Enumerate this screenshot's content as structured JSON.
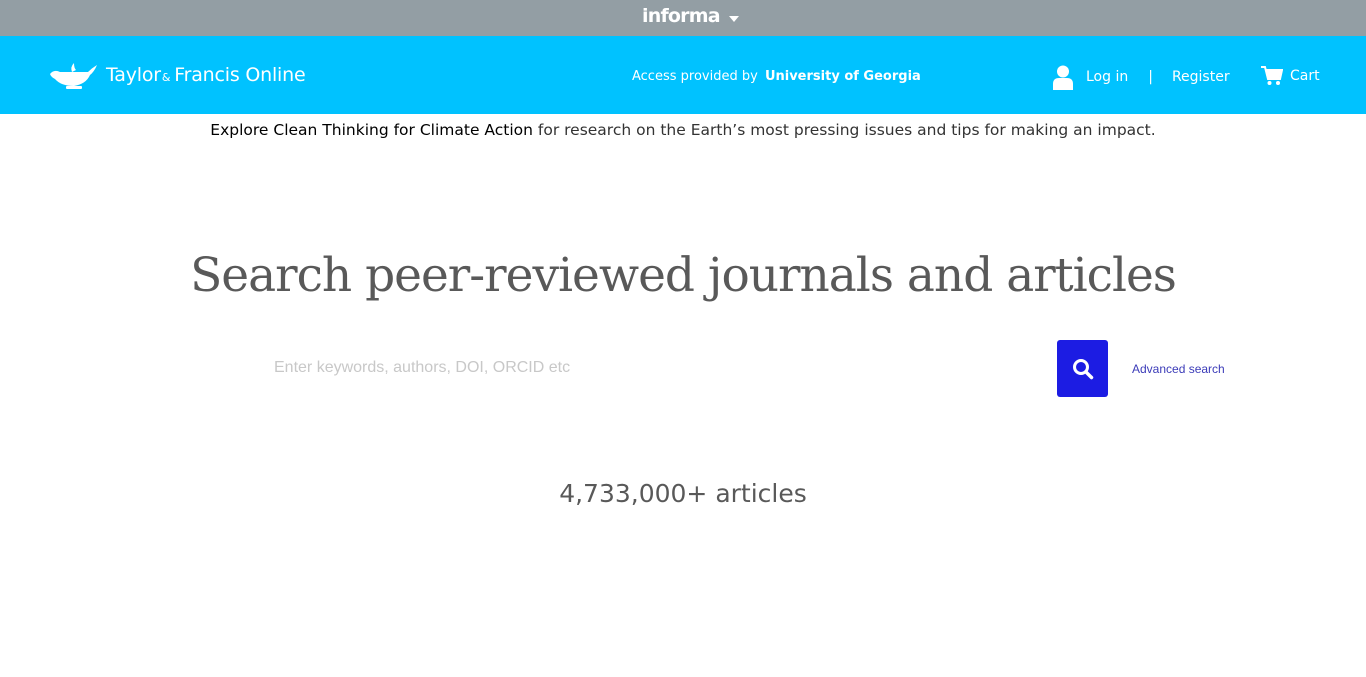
{
  "topbar": {
    "brand": "informa",
    "caret_icon": "chevron-down-icon"
  },
  "header": {
    "logo_name": "Taylor",
    "logo_amp": "&",
    "logo_rest": "Francis Online",
    "access_prefix": "Access provided by",
    "access_institution": "University of Georgia",
    "login_label": "Log in",
    "separator": "|",
    "register_label": "Register",
    "cart_label": "Cart",
    "colors": {
      "topbar_bg": "#939ea4",
      "header_bg": "#00c2ff"
    }
  },
  "promo": {
    "link_text": "Explore Clean Thinking for Climate Action",
    "rest_text": "for research on the Earth’s most pressing issues and tips for making an impact."
  },
  "hero": {
    "headline": "Search peer-reviewed journals and articles"
  },
  "search": {
    "placeholder": "Enter keywords, authors, DOI, ORCID etc",
    "value": "",
    "button_icon": "search-icon",
    "button_color": "#1c1ce3",
    "advanced_label": "Advanced search"
  },
  "stats": {
    "article_count": "4,733,000+ articles"
  }
}
